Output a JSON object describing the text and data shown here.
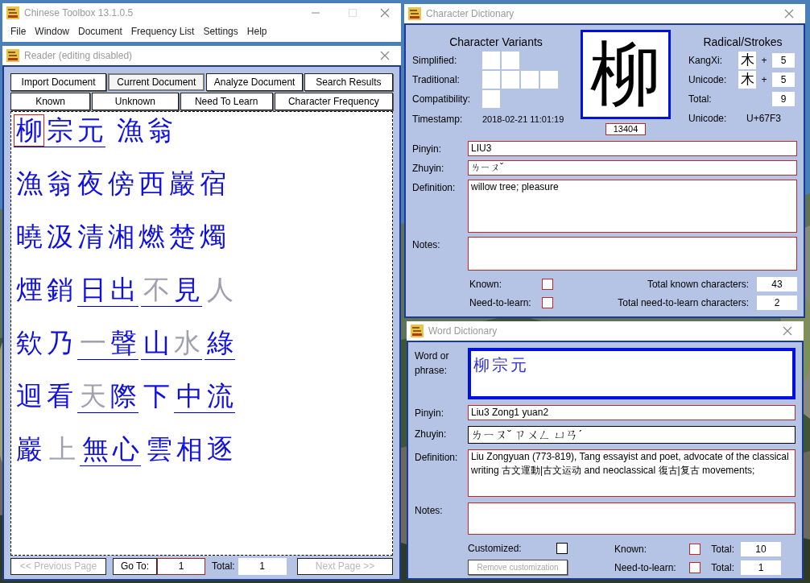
{
  "app": {
    "title": "Chinese Toolbox 13.1.0.5",
    "menu": [
      "File",
      "Window",
      "Document",
      "Frequency List",
      "Settings",
      "Help"
    ]
  },
  "reader": {
    "title": "Reader (editing disabled)",
    "tabs": [
      {
        "label": "Import Document",
        "selected": false
      },
      {
        "label": "Current Document",
        "selected": true
      },
      {
        "label": "Analyze Document",
        "selected": false
      },
      {
        "label": "Search Results",
        "selected": false
      },
      {
        "label": "Known",
        "selected": false
      },
      {
        "label": "Unknown",
        "selected": false
      },
      {
        "label": "Need To Learn",
        "selected": false
      },
      {
        "label": "Character Frequency",
        "selected": false
      }
    ],
    "lines": [
      [
        {
          "underlined": true,
          "chars": [
            {
              "text": "柳",
              "known": true,
              "selected": true
            },
            {
              "text": "宗",
              "known": true,
              "selected": false
            },
            {
              "text": "元",
              "known": true,
              "selected": false
            }
          ]
        },
        {
          "underlined": false,
          "chars": [
            {
              "text": "漁",
              "known": true,
              "selected": false
            },
            {
              "text": "翁",
              "known": true,
              "selected": false
            }
          ]
        }
      ],
      [
        {
          "underlined": false,
          "chars": [
            {
              "text": "漁",
              "known": true,
              "selected": false
            },
            {
              "text": "翁",
              "known": true,
              "selected": false
            },
            {
              "text": "夜",
              "known": true,
              "selected": false
            },
            {
              "text": "傍",
              "known": true,
              "selected": false
            },
            {
              "text": "西",
              "known": true,
              "selected": false
            },
            {
              "text": "巖",
              "known": true,
              "selected": false
            },
            {
              "text": "宿",
              "known": true,
              "selected": false
            }
          ]
        }
      ],
      [
        {
          "underlined": false,
          "chars": [
            {
              "text": "曉",
              "known": true,
              "selected": false
            },
            {
              "text": "汲",
              "known": true,
              "selected": false
            },
            {
              "text": "清",
              "known": true,
              "selected": false
            },
            {
              "text": "湘",
              "known": true,
              "selected": false
            },
            {
              "text": "燃",
              "known": true,
              "selected": false
            },
            {
              "text": "楚",
              "known": true,
              "selected": false
            },
            {
              "text": "燭",
              "known": true,
              "selected": false
            }
          ]
        }
      ],
      [
        {
          "underlined": false,
          "chars": [
            {
              "text": "煙",
              "known": true,
              "selected": false
            },
            {
              "text": "銷",
              "known": true,
              "selected": false
            }
          ]
        },
        {
          "underlined": true,
          "chars": [
            {
              "text": "日",
              "known": true,
              "selected": false
            },
            {
              "text": "出",
              "known": true,
              "selected": false
            }
          ]
        },
        {
          "underlined": true,
          "chars": [
            {
              "text": "不",
              "known": false,
              "selected": false
            },
            {
              "text": "見",
              "known": true,
              "selected": false
            }
          ]
        },
        {
          "underlined": false,
          "chars": [
            {
              "text": "人",
              "known": false,
              "selected": false
            }
          ]
        }
      ],
      [
        {
          "underlined": false,
          "chars": [
            {
              "text": "欸",
              "known": true,
              "selected": false
            },
            {
              "text": "乃",
              "known": true,
              "selected": false
            }
          ]
        },
        {
          "underlined": true,
          "chars": [
            {
              "text": "一",
              "known": false,
              "selected": false
            },
            {
              "text": "聲",
              "known": true,
              "selected": false
            }
          ]
        },
        {
          "underlined": true,
          "chars": [
            {
              "text": "山",
              "known": true,
              "selected": false
            },
            {
              "text": "水",
              "known": false,
              "selected": false
            }
          ]
        },
        {
          "underlined": true,
          "chars": [
            {
              "text": "綠",
              "known": true,
              "selected": false
            }
          ]
        }
      ],
      [
        {
          "underlined": false,
          "chars": [
            {
              "text": "迴",
              "known": true,
              "selected": false
            },
            {
              "text": "看",
              "known": true,
              "selected": false
            }
          ]
        },
        {
          "underlined": true,
          "chars": [
            {
              "text": "天",
              "known": false,
              "selected": false
            },
            {
              "text": "際",
              "known": true,
              "selected": false
            }
          ]
        },
        {
          "underlined": false,
          "chars": [
            {
              "text": "下",
              "known": true,
              "selected": false
            }
          ]
        },
        {
          "underlined": true,
          "chars": [
            {
              "text": "中",
              "known": true,
              "selected": false
            },
            {
              "text": "流",
              "known": true,
              "selected": false
            }
          ]
        }
      ],
      [
        {
          "underlined": false,
          "chars": [
            {
              "text": "巖",
              "known": true,
              "selected": false
            }
          ]
        },
        {
          "underlined": false,
          "chars": [
            {
              "text": "上",
              "known": false,
              "selected": false
            }
          ]
        },
        {
          "underlined": true,
          "chars": [
            {
              "text": "無",
              "known": true,
              "selected": false
            },
            {
              "text": "心",
              "known": true,
              "selected": false
            }
          ]
        },
        {
          "underlined": false,
          "chars": [
            {
              "text": "雲",
              "known": true,
              "selected": false
            },
            {
              "text": "相",
              "known": true,
              "selected": false
            },
            {
              "text": "逐",
              "known": true,
              "selected": false
            }
          ]
        }
      ]
    ],
    "pager": {
      "previous": {
        "label": "<< Previous Page",
        "disabled": true
      },
      "goto": "Go To:",
      "page": "1",
      "total_label": "Total:",
      "total": "1",
      "next": {
        "label": "Next Page >>",
        "disabled": true
      }
    }
  },
  "character_dictionary": {
    "title": "Character Dictionary",
    "variants": {
      "heading": "Character Variants",
      "rows": [
        {
          "label": "Simplified:",
          "slots": [
            {
              "kind": "empty"
            },
            {
              "kind": "empty"
            }
          ]
        },
        {
          "label": "Traditional:",
          "slots": [
            {
              "kind": "empty"
            },
            {
              "kind": "empty"
            },
            {
              "kind": "empty"
            },
            {
              "kind": "empty"
            }
          ]
        },
        {
          "label": "Compatibility:",
          "slots": [
            {
              "kind": "empty"
            }
          ]
        }
      ]
    },
    "timestamp_label": "Timestamp:",
    "timestamp": "2018-02-21 11:01:19",
    "character": "柳",
    "frequency": "13404",
    "radical": {
      "heading": "Radical/Strokes",
      "rows": [
        {
          "label": "KangXi:",
          "radical": "木",
          "plus": "+",
          "strokes": "5"
        },
        {
          "label": "Unicode:",
          "radical": "木",
          "plus": "+",
          "strokes": "5"
        },
        {
          "label": "Total:",
          "strokes": "9"
        }
      ],
      "unicode_label": "Unicode:",
      "unicode": "U+67F3"
    },
    "fields": [
      {
        "label": "Pinyin:",
        "value": "LIU3",
        "kind": "line"
      },
      {
        "label": "Zhuyin:",
        "value": "ㄌㄧㄡˇ",
        "kind": "line"
      },
      {
        "label": "Definition:",
        "value": "willow tree; pleasure",
        "kind": "area"
      },
      {
        "label": "Notes:",
        "kind": "notes"
      }
    ],
    "flags": [
      {
        "label": "Known:",
        "checked": false,
        "total_label": "Total known characters:",
        "total": "43"
      },
      {
        "label": "Need-to-learn:",
        "checked": false,
        "total_label": "Total need-to-learn characters:",
        "total": "2"
      }
    ]
  },
  "word_dictionary": {
    "title": "Word Dictionary",
    "fields": [
      {
        "label": "Word or phrase:",
        "value": "柳宗元",
        "kind": "phrase"
      },
      {
        "label": "Pinyin:",
        "value": "Liu3 Zong1 yuan2",
        "kind": "line"
      },
      {
        "label": "Zhuyin:",
        "value": "ㄌㄧㄡˇ ㄗㄨㄥ ㄩㄢˊ",
        "kind": "box"
      },
      {
        "label": "Definition:",
        "value": "Liu Zongyuan (773-819),  Tang essayist and poet,  advocate of the classical writing 古文運動|古文运动 and neoclassical 復古|复古 movements;",
        "kind": "area"
      },
      {
        "label": "Notes:",
        "kind": "notes"
      }
    ],
    "customized": {
      "label": "Customized:",
      "checked": false
    },
    "remove_button": {
      "label": "Remove customization",
      "disabled": true
    },
    "flags": [
      {
        "label": "Known:",
        "checked": false,
        "total_label": "Total:",
        "total": "10"
      },
      {
        "label": "Need-to-learn:",
        "checked": false,
        "total_label": "Total:",
        "total": "1"
      }
    ]
  }
}
